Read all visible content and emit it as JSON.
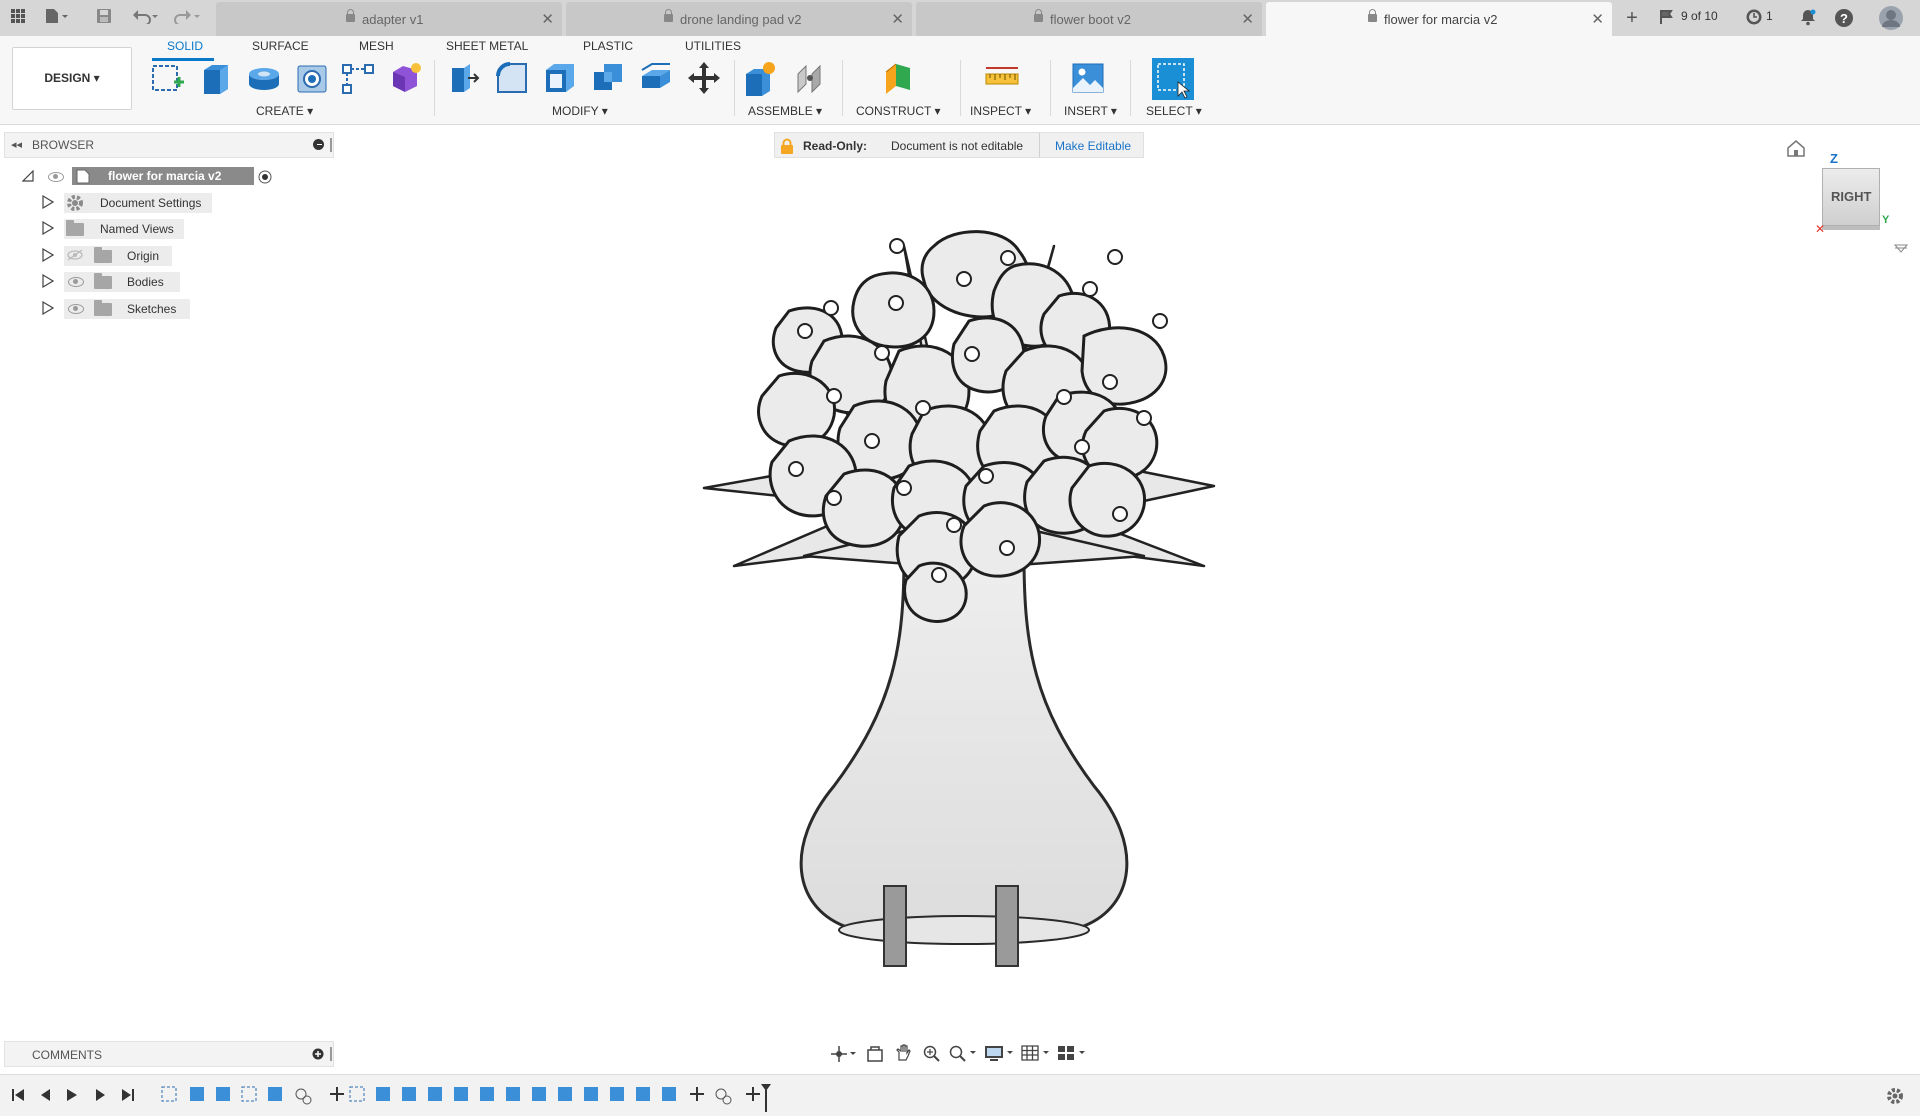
{
  "tabs": [
    {
      "label": "adapter v1",
      "active": false
    },
    {
      "label": "drone landing pad v2",
      "active": false
    },
    {
      "label": "flower boot v2",
      "active": false
    },
    {
      "label": "flower for marcia v2",
      "active": true
    }
  ],
  "status": {
    "versions": "9 of 10",
    "jobs": "1"
  },
  "toolbar": {
    "design_label": "DESIGN",
    "workspace_tabs": [
      "SOLID",
      "SURFACE",
      "MESH",
      "SHEET METAL",
      "PLASTIC",
      "UTILITIES"
    ],
    "active_workspace": "SOLID",
    "groups": {
      "create": "CREATE",
      "modify": "MODIFY",
      "assemble": "ASSEMBLE",
      "construct": "CONSTRUCT",
      "inspect": "INSPECT",
      "insert": "INSERT",
      "select": "SELECT"
    }
  },
  "browser": {
    "title": "BROWSER",
    "root": "flower for marcia v2",
    "items": [
      {
        "label": "Document Settings",
        "icon": "gear-icon"
      },
      {
        "label": "Named Views",
        "icon": "folder-icon"
      },
      {
        "label": "Origin",
        "icon": "folder-icon"
      },
      {
        "label": "Bodies",
        "icon": "folder-icon"
      },
      {
        "label": "Sketches",
        "icon": "folder-icon"
      }
    ]
  },
  "readonly": {
    "label": "Read-Only:",
    "message": "Document is not editable",
    "action": "Make Editable"
  },
  "viewcube": {
    "face": "RIGHT",
    "axis_z": "Z",
    "axis_y": "Y"
  },
  "comments": {
    "title": "COMMENTS"
  },
  "colors": {
    "accent": "#0a78c8",
    "tab_bar": "#d6d6d6",
    "toolbar": "#f7f7f7",
    "readonly_lock": "#f5a623",
    "select_tool": "#1a8fd6"
  }
}
